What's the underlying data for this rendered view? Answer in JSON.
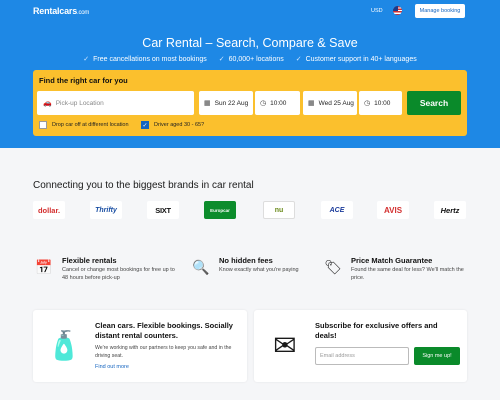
{
  "header": {
    "logo": "Rentalcars",
    "logo_suffix": ".com",
    "currency": "USD",
    "flag_icon": "us-flag-icon",
    "manage_booking": "Manage booking"
  },
  "hero": {
    "title": "Car Rental – Search, Compare & Save",
    "features": [
      "Free cancellations on most bookings",
      "60,000+ locations",
      "Customer support in 40+ languages"
    ],
    "background": "#1e88e5"
  },
  "search": {
    "heading": "Find the right car for you",
    "pickup_placeholder": "Pick-up Location",
    "pickup_date": "Sun 22 Aug",
    "pickup_time": "10:00",
    "dropoff_date": "Wed 25 Aug",
    "dropoff_time": "10:00",
    "search_button": "Search",
    "option_different_location": "Drop car off at different location",
    "option_different_location_checked": false,
    "option_driver_age": "Driver aged 30 - 65?",
    "option_driver_age_checked": true,
    "box_color": "#fbc02d",
    "button_color": "#0a8a2a"
  },
  "brands": {
    "title": "Connecting you to the biggest brands in car rental",
    "logos": [
      "dollar.",
      "Thrifty",
      "SIXT",
      "Europcar",
      "nu",
      "ACE",
      "AVIS",
      "Hertz"
    ]
  },
  "benefits": [
    {
      "icon": "calendar-icon",
      "title": "Flexible rentals",
      "text": "Cancel or change most bookings for free up to 48 hours before pick-up"
    },
    {
      "icon": "magnifier-icon",
      "title": "No hidden fees",
      "text": "Know exactly what you're paying"
    },
    {
      "icon": "price-tag-icon",
      "title": "Price Match Guarantee",
      "text": "Found the same deal for less? We'll match the price."
    }
  ],
  "cards": {
    "clean": {
      "title": "Clean cars. Flexible bookings. Socially distant rental counters.",
      "text": "We're working with our partners to keep you safe and in the driving seat.",
      "link": "Find out more"
    },
    "subscribe": {
      "title": "Subscribe for exclusive offers and deals!",
      "email_placeholder": "Email address",
      "button": "Sign me up!"
    }
  }
}
